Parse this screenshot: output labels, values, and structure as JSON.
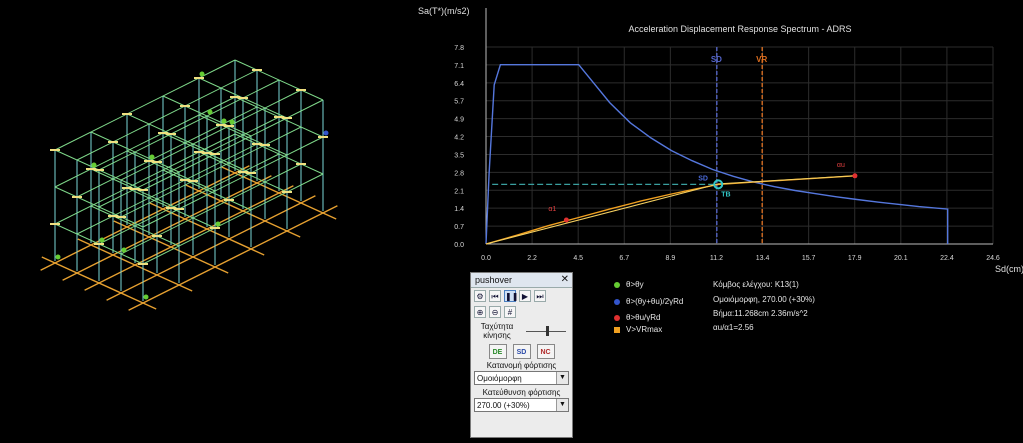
{
  "colors": {
    "structure_green": "#7fd98a",
    "structure_cyan": "#7ad8d8",
    "foundation_orange": "#e6a030",
    "hinge_yellow": "#f0e080",
    "spectrum_blue": "#5577dd",
    "capacity_orange": "#f0a020",
    "sd_line": "#5566cc",
    "vr_line": "#e07020",
    "marker_red": "#e03030",
    "marker_green": "#66cc33",
    "marker_blue": "#3355cc",
    "marker_orange": "#f0a020",
    "tb_cyan": "#33c8c8"
  },
  "chart_data": {
    "type": "line",
    "title": "Acceleration Displacement Response Spectrum - ADRS",
    "xlabel": "Sd(cm)",
    "ylabel": "Sa(T*)(m/s2)",
    "xlim": [
      0,
      24.6
    ],
    "ylim": [
      0,
      7.8
    ],
    "x_ticks": [
      "0.0",
      "2.2",
      "4.5",
      "6.7",
      "8.9",
      "11.2",
      "13.4",
      "15.7",
      "17.9",
      "20.1",
      "22.4",
      "24.6"
    ],
    "y_ticks": [
      "0.0",
      "0.7",
      "1.4",
      "2.1",
      "2.8",
      "3.5",
      "4.2",
      "4.9",
      "5.7",
      "6.4",
      "7.1",
      "7.8"
    ],
    "grid": true,
    "series": [
      {
        "role": "demand-spectrum",
        "x": [
          0.0,
          0.15,
          0.4,
          0.7,
          4.5,
          5.2,
          6.0,
          7.0,
          8.0,
          9.0,
          10.0,
          11.0,
          12.0,
          13.0,
          14.0,
          15.0,
          16.0,
          17.0,
          18.0,
          19.0,
          20.0,
          21.0,
          22.4,
          22.4
        ],
        "y": [
          0.0,
          2.8,
          6.3,
          7.1,
          7.1,
          6.4,
          5.6,
          4.8,
          4.2,
          3.7,
          3.3,
          2.95,
          2.68,
          2.45,
          2.27,
          2.12,
          1.99,
          1.87,
          1.76,
          1.66,
          1.57,
          1.48,
          1.38,
          0.0
        ]
      },
      {
        "role": "capacity-curve",
        "x": [
          0.0,
          1.5,
          3.0,
          4.5,
          6.0,
          7.5,
          9.0,
          10.0,
          11.268,
          13.0,
          15.0,
          17.9
        ],
        "y": [
          0.0,
          0.35,
          0.72,
          1.05,
          1.38,
          1.7,
          1.98,
          2.15,
          2.36,
          2.45,
          2.55,
          2.7
        ]
      },
      {
        "role": "bilinear",
        "x": [
          0.0,
          11.268,
          17.9
        ],
        "y": [
          0.0,
          2.38,
          2.7
        ]
      }
    ],
    "vertical_lines": [
      {
        "label": "SD",
        "x": 11.2
      },
      {
        "label": "VR",
        "x": 13.4
      }
    ],
    "dashed_target": {
      "x": 11.268,
      "y": 2.36
    },
    "points": [
      {
        "label": "α1",
        "x": 3.9,
        "y": 0.95
      },
      {
        "label": "αu",
        "x": 17.9,
        "y": 2.7
      },
      {
        "label": "TB",
        "x": 11.268,
        "y": 2.36
      }
    ],
    "annotation_sd": "SD"
  },
  "legend": [
    {
      "label": "θ>θy",
      "marker": "dot",
      "color": "#66cc33"
    },
    {
      "label": "θ>(θy+θu)/2γRd",
      "marker": "dot",
      "color": "#3355cc"
    },
    {
      "label": "θ>θu/γRd",
      "marker": "dot",
      "color": "#e03030"
    },
    {
      "label": "V>VRmax",
      "marker": "square",
      "color": "#f0a020"
    }
  ],
  "info": {
    "control_node": "Κόμβος ελέγχου: Κ13(1)",
    "load_pattern": "Ομοιόμορφη, 270.00 (+30%)",
    "step": "Βήμα:11.268cm 2.36m/s^2",
    "ratio": "αu/α1=2.56"
  },
  "panel": {
    "title": "pushover",
    "speed_label": "Ταχύτητα κίνησης",
    "speed_level": 0.55,
    "distribution_label": "Κατανομή φόρτισης",
    "distribution_value": "Ομοιόμορφη",
    "direction_label": "Κατεύθυνση φόρτισης",
    "direction_value": "270.00 (+30%)",
    "btn_de": "DE",
    "btn_sd": "SD",
    "btn_nc": "NC",
    "icons": [
      "settings-icon",
      "skip-back-icon",
      "pause-icon",
      "play-icon",
      "skip-forward-icon",
      "zoom-in-icon",
      "zoom-out-icon",
      "grid-icon"
    ]
  }
}
